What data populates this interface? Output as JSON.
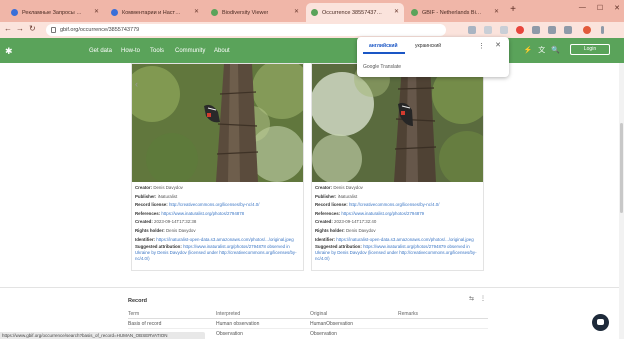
{
  "browser": {
    "tabs": [
      {
        "label": "Рекламные Запросы Aleksander",
        "active": false,
        "favicon_color": "#3a6fd8"
      },
      {
        "label": "Комментарии и Настройки",
        "active": false,
        "favicon_color": "#3a6fd8"
      },
      {
        "label": "Biodiversity Viewer",
        "active": false,
        "favicon_color": "#5aa35a"
      },
      {
        "label": "Occurrence 3855743779",
        "active": true,
        "favicon_color": "#5aa35a"
      },
      {
        "label": "GBIF - Netherlands Biodiversity",
        "active": false,
        "favicon_color": "#5aa35a"
      }
    ],
    "new_tab": "+",
    "window_controls": {
      "minimize": "—",
      "maximize": "☐",
      "close": "✕"
    },
    "url": "gbif.org/occurrence/3855743779",
    "nav": {
      "back": "←",
      "forward": "→",
      "reload": "↻"
    }
  },
  "site_nav": {
    "logo": "✱",
    "links": [
      "Get data",
      "How-to",
      "Tools",
      "Community",
      "About"
    ],
    "right_icons": [
      "⚡",
      "文",
      "🔍"
    ],
    "login": "Login"
  },
  "translate_popup": {
    "source_lang": "английский",
    "target_lang": "украинский",
    "brand": "Google Translate",
    "menu": "⋮",
    "close": "✕"
  },
  "media_cards": [
    {
      "creator": "Denis Davydov",
      "publisher": "iNaturalist",
      "record_license": "http://creativecommons.org/licenses/by-nc/4.0/",
      "references": "https://www.inaturalist.org/photos/2794878",
      "created": "2023-09-14T17:32:38",
      "rights_holder": "Denis Davydov",
      "identifier": "https://inaturalist-open-data.s3.amazonaws.com/photos/.../original.jpeg",
      "suggested_attribution": "https://www.inaturalist.org/photos/2794878 observed in Ukraine by Denis Davydov (licensed under http://creativecommons.org/licenses/by-nc/4.0/)"
    },
    {
      "creator": "Denis Davydov",
      "publisher": "iNaturalist",
      "record_license": "http://creativecommons.org/licenses/by-nc/4.0/",
      "references": "https://www.inaturalist.org/photos/2794879",
      "created": "2023-09-14T17:32:40",
      "rights_holder": "Denis Davydov",
      "identifier": "https://inaturalist-open-data.s3.amazonaws.com/photos/.../original.jpeg",
      "suggested_attribution": "https://www.inaturalist.org/photos/2794879 observed in Ukraine by Denis Davydov (licensed under http://creativecommons.org/licenses/by-nc/4.0/)"
    }
  ],
  "field_labels": {
    "creator": "Creator:",
    "publisher": "Publisher:",
    "record_license": "Record license:",
    "references": "References:",
    "created": "Created:",
    "rights_holder": "Rights holder:",
    "identifier": "Identifier:",
    "suggested_attribution": "Suggested attribution:"
  },
  "record": {
    "title": "Record",
    "columns": [
      "Term",
      "Interpreted",
      "Original",
      "Remarks"
    ],
    "rows": [
      {
        "term": "Basis of record",
        "interpreted": "Human observation",
        "original": "HumanObservation",
        "remarks": ""
      },
      {
        "term": "",
        "interpreted": "Observation",
        "original": "Observation",
        "remarks": ""
      }
    ]
  },
  "status_bar": "https://www.gbif.org/occurrence/search?basis_of_record=HUMAN_OBSERVATION",
  "colors": {
    "accent_green": "#5aa35a",
    "tab_bar": "#f0b6a8",
    "link_blue": "#3a75c4"
  }
}
